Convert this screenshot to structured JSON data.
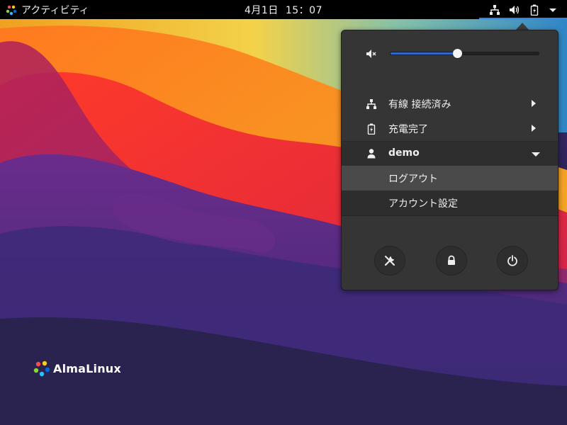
{
  "topbar": {
    "activities_label": "アクティビティ",
    "clock_date": "4月1日",
    "clock_time": "15：07",
    "status_icons": [
      "network-wired-icon",
      "volume-icon",
      "battery-charging-icon",
      "menu-arrow-icon"
    ]
  },
  "menu": {
    "volume": {
      "icon": "volume-muted-icon",
      "level": 0.45
    },
    "items": [
      {
        "icon": "network-wired-icon",
        "label": "有線 接続済み"
      },
      {
        "icon": "battery-charging-icon",
        "label": "充電完了"
      }
    ],
    "user": {
      "icon": "user-icon",
      "name": "demo",
      "submenu": [
        "ログアウト",
        "アカウント設定"
      ]
    },
    "buttons": [
      "settings-icon",
      "lock-icon",
      "power-icon"
    ]
  },
  "desktop": {
    "logo_text": "AlmaLinux"
  },
  "colors": {
    "accent": "#3584e4",
    "menu_bg": "#353535",
    "highlight": "#4a4a4a"
  }
}
